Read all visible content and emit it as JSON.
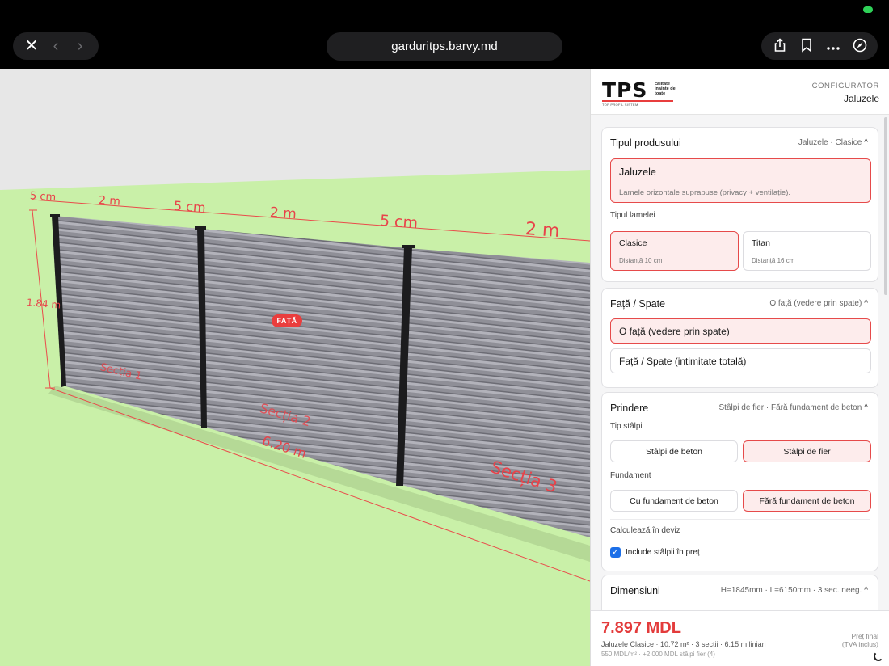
{
  "browser": {
    "url": "garduritps.barvy.md",
    "nav_close": "✕",
    "nav_back": "‹",
    "nav_forward": "›",
    "share_icon": "share-icon",
    "bookmark_icon": "bookmark-icon",
    "more_icon": "more-icon",
    "compass_icon": "compass-icon"
  },
  "scene": {
    "dims": {
      "gap_left": "5 cm",
      "width_1": "2 m",
      "gap_2": "5 cm",
      "width_2": "2 m",
      "gap_3": "5 cm",
      "width_3": "2 m",
      "height": "1.84 m",
      "total_length": "6.20 m"
    },
    "sections": [
      "Secția 1",
      "Secția 2",
      "Secția 3"
    ],
    "face_badge": "FAȚĂ",
    "colors": {
      "grass": "#c9f0a8",
      "sky": "#e7e7e7",
      "accent": "#e8434a",
      "slat": "#8e8e96"
    }
  },
  "panel": {
    "logo": {
      "letters": "TPS",
      "tagline": "calitate inainte de toate",
      "sub": "TOP PROFIL SISTEM"
    },
    "configurator_label": "CONFIGURATOR",
    "configurator_value": "Jaluzele",
    "product": {
      "title": "Tipul produsului",
      "summary": "Jaluzele · Clasice",
      "chevron": "^",
      "option_title": "Jaluzele",
      "option_desc": "Lamele orizontale suprapuse (privacy + ventilație).",
      "slat_label": "Tipul lamelei",
      "slats": [
        {
          "name": "Clasice",
          "desc": "Distanță 10 cm"
        },
        {
          "name": "Titan",
          "desc": "Distanță 16 cm"
        }
      ]
    },
    "face": {
      "title": "Față / Spate",
      "summary": "O față (vedere prin spate)",
      "chevron": "^",
      "options": [
        "O față (vedere prin spate)",
        "Față / Spate (intimitate totală)"
      ]
    },
    "mount": {
      "title": "Prindere",
      "summary": "Stâlpi de fier · Fără fundament de beton",
      "chevron": "^",
      "posts_label": "Tip stâlpi",
      "posts": [
        "Stâlpi de beton",
        "Stâlpi de fier"
      ],
      "foundation_label": "Fundament",
      "foundation": [
        "Cu fundament de beton",
        "Fără fundament de beton"
      ],
      "calc_label": "Calculează în deviz",
      "check_mark": "✓",
      "include_label": "Include stâlpii în preț"
    },
    "dims": {
      "title": "Dimensiuni",
      "summary": "H=1845mm · L=6150mm · 3 sec. neeg.",
      "chevron": "^"
    },
    "price": {
      "total": "7.897 MDL",
      "line1": "Jaluzele Clasice · 10.72 m² · 3 secții · 6.15 m liniari",
      "line2": "550 MDL/m² · +2.000 MDL stâlpi fier (4)",
      "final_1": "Preț final",
      "final_2": "(TVA inclus)"
    }
  }
}
